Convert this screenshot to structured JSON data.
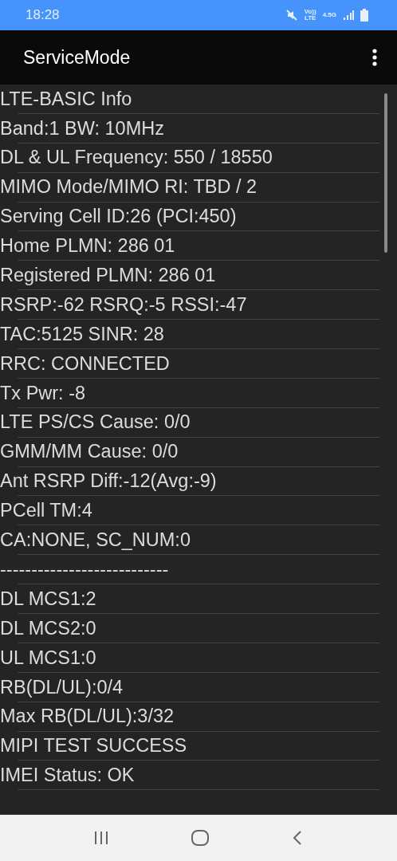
{
  "status_bar": {
    "time": "18:28",
    "volte_top": "Vo))",
    "volte_bottom": "LTE",
    "network": "4.5G"
  },
  "app_bar": {
    "title": "ServiceMode"
  },
  "lines": [
    "LTE-BASIC Info",
    "Band:1 BW: 10MHz",
    "DL & UL Frequency: 550 / 18550",
    "MIMO Mode/MIMO RI: TBD / 2",
    "Serving Cell ID:26 (PCI:450)",
    "Home PLMN: 286 01",
    "Registered PLMN: 286 01",
    "RSRP:-62 RSRQ:-5 RSSI:-47",
    "TAC:5125 SINR: 28",
    "RRC: CONNECTED",
    "Tx Pwr: -8",
    "LTE PS/CS Cause: 0/0",
    "GMM/MM Cause: 0/0",
    "Ant RSRP Diff:-12(Avg:-9)",
    "PCell TM:4",
    "CA:NONE, SC_NUM:0",
    "---------------------------",
    "DL MCS1:2",
    "DL MCS2:0",
    "UL MCS1:0",
    "RB(DL/UL):0/4",
    "Max RB(DL/UL):3/32",
    "MIPI TEST SUCCESS",
    "IMEI Status: OK"
  ]
}
